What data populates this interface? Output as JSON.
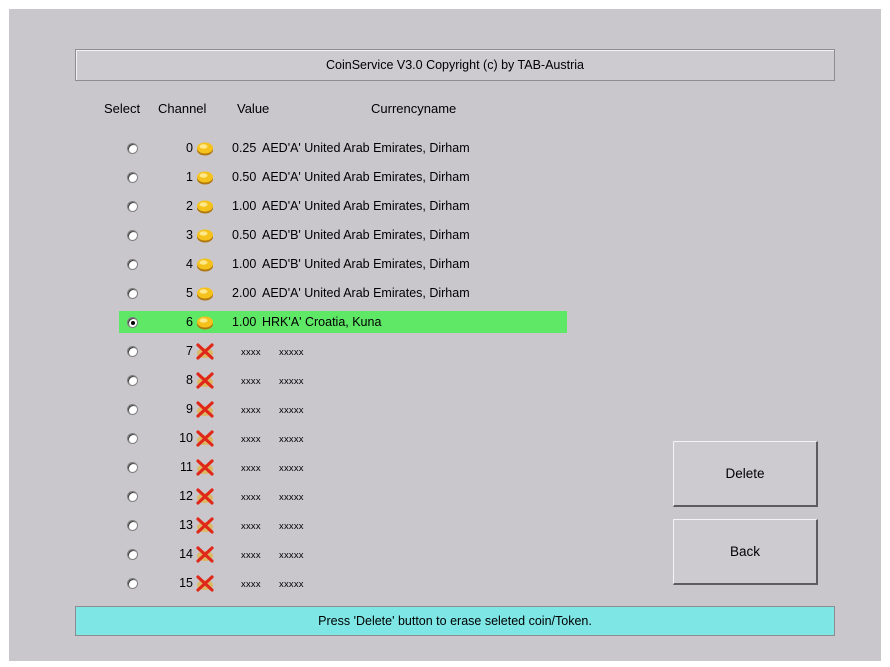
{
  "title": "CoinService V3.0 Copyright (c) by TAB-Austria",
  "columns": {
    "select": "Select",
    "channel": "Channel",
    "value": "Value",
    "currency": "Currencyname"
  },
  "rows": [
    {
      "channel": "0",
      "value": "0.25",
      "currency": "AED'A' United Arab Emirates, Dirham",
      "icon": "coin-icon",
      "selected": false
    },
    {
      "channel": "1",
      "value": "0.50",
      "currency": "AED'A' United Arab Emirates, Dirham",
      "icon": "coin-icon",
      "selected": false
    },
    {
      "channel": "2",
      "value": "1.00",
      "currency": "AED'A' United Arab Emirates, Dirham",
      "icon": "coin-icon",
      "selected": false
    },
    {
      "channel": "3",
      "value": "0.50",
      "currency": "AED'B' United Arab Emirates, Dirham",
      "icon": "coin-icon",
      "selected": false
    },
    {
      "channel": "4",
      "value": "1.00",
      "currency": "AED'B' United Arab Emirates, Dirham",
      "icon": "coin-icon",
      "selected": false
    },
    {
      "channel": "5",
      "value": "2.00",
      "currency": "AED'A' United Arab Emirates, Dirham",
      "icon": "coin-icon",
      "selected": false
    },
    {
      "channel": "6",
      "value": "1.00",
      "currency": "HRK'A' Croatia, Kuna",
      "icon": "coin-icon",
      "selected": true
    },
    {
      "channel": "7",
      "value": "xxxx",
      "currency": "xxxxx",
      "icon": "cross-icon",
      "selected": false
    },
    {
      "channel": "8",
      "value": "xxxx",
      "currency": "xxxxx",
      "icon": "cross-icon",
      "selected": false
    },
    {
      "channel": "9",
      "value": "xxxx",
      "currency": "xxxxx",
      "icon": "cross-icon",
      "selected": false
    },
    {
      "channel": "10",
      "value": "xxxx",
      "currency": "xxxxx",
      "icon": "cross-icon",
      "selected": false
    },
    {
      "channel": "11",
      "value": "xxxx",
      "currency": "xxxxx",
      "icon": "cross-icon",
      "selected": false
    },
    {
      "channel": "12",
      "value": "xxxx",
      "currency": "xxxxx",
      "icon": "cross-icon",
      "selected": false
    },
    {
      "channel": "13",
      "value": "xxxx",
      "currency": "xxxxx",
      "icon": "cross-icon",
      "selected": false
    },
    {
      "channel": "14",
      "value": "xxxx",
      "currency": "xxxxx",
      "icon": "cross-icon",
      "selected": false
    },
    {
      "channel": "15",
      "value": "xxxx",
      "currency": "xxxxx",
      "icon": "cross-icon",
      "selected": false
    }
  ],
  "buttons": {
    "delete": "Delete",
    "back": "Back"
  },
  "status": "Press 'Delete' button to erase seleted coin/Token.",
  "colors": {
    "window": "#cac7cc",
    "selected_row": "#5fe866",
    "status_bar": "#7fe6e6"
  }
}
